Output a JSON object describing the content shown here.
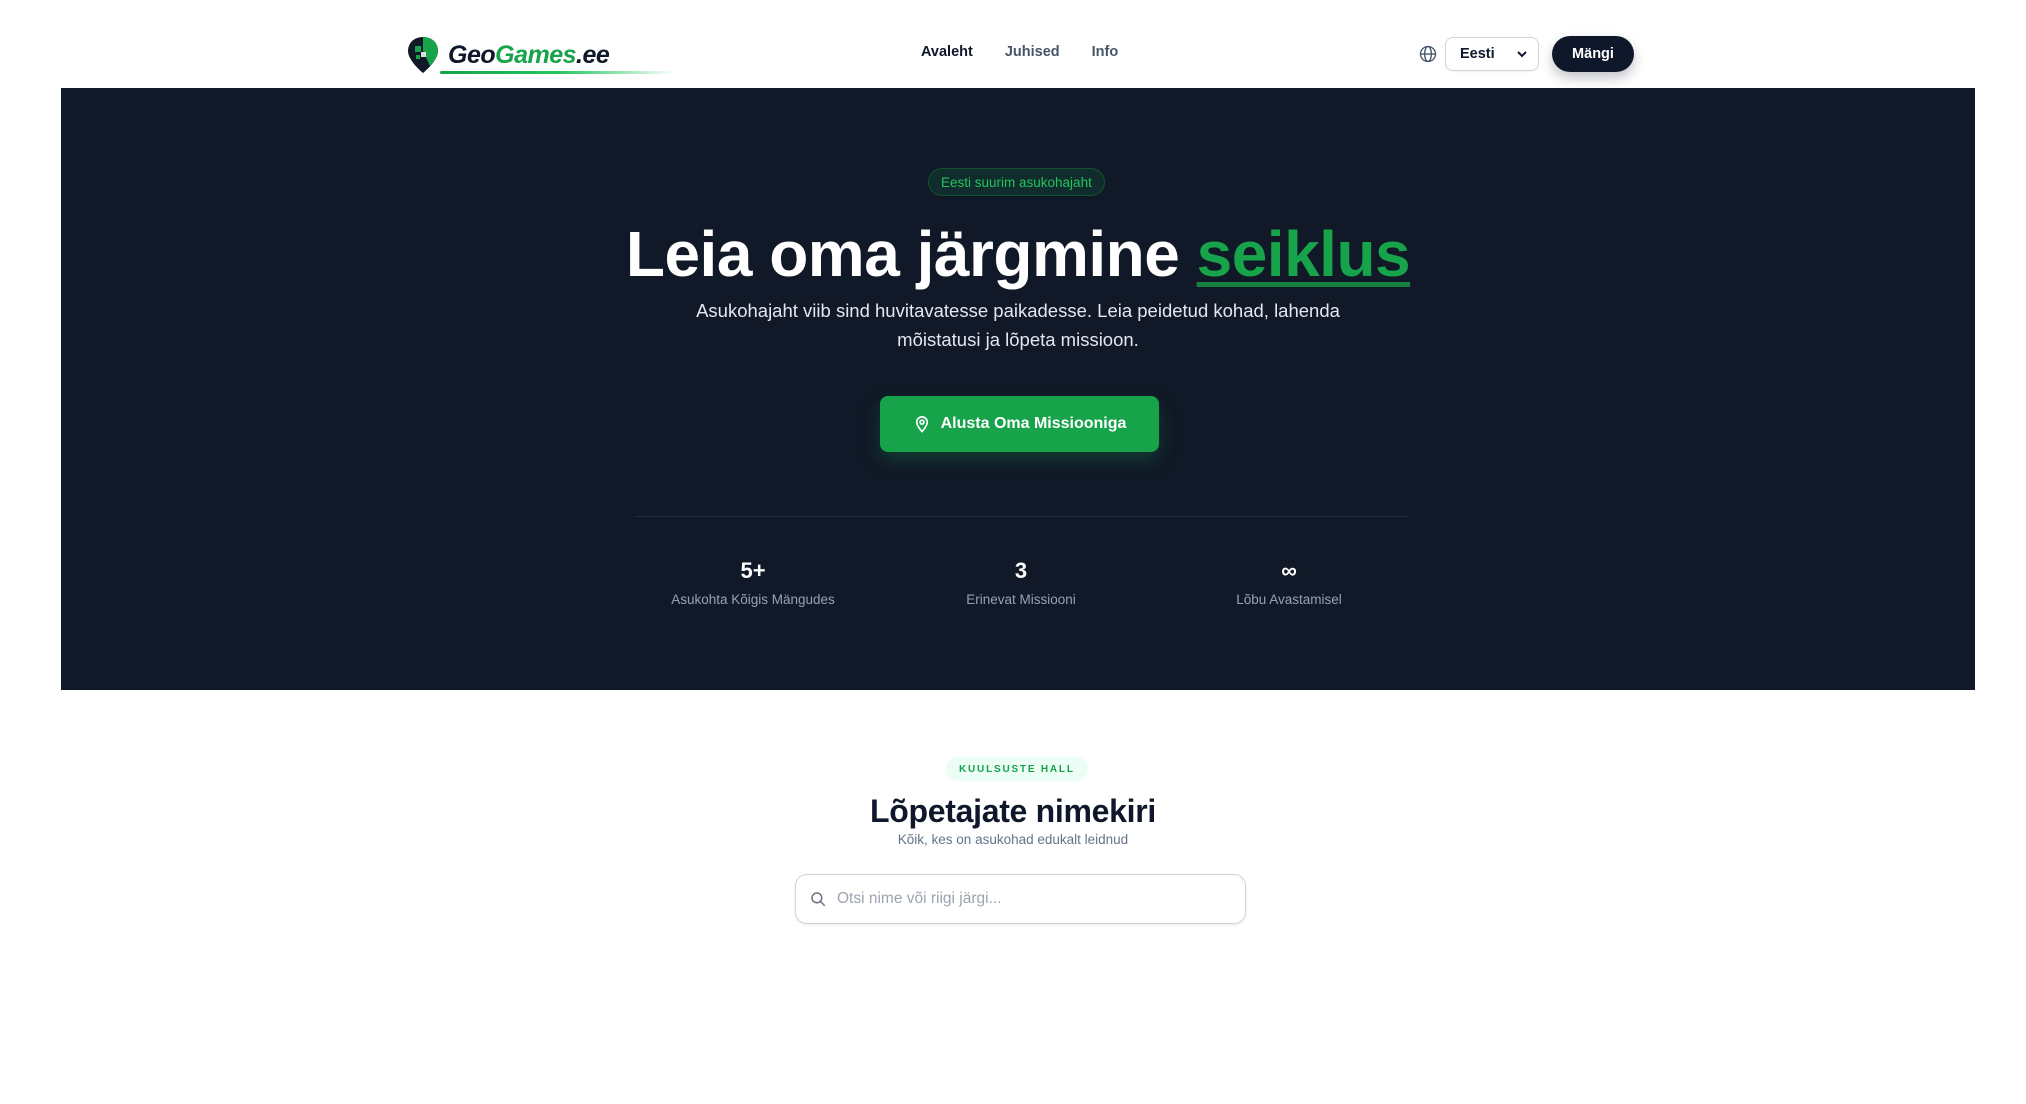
{
  "header": {
    "logo_part1": "Geo",
    "logo_part2": "Games",
    "logo_part3": ".ee",
    "nav": [
      {
        "label": "Avaleht",
        "active": true
      },
      {
        "label": "Juhised",
        "active": false
      },
      {
        "label": "Info",
        "active": false
      }
    ],
    "language": {
      "selected": "Eesti",
      "icon": "globe-icon"
    },
    "play_label": "Mängi"
  },
  "hero": {
    "badge": "Eesti suurim asukohajaht",
    "title_main": "Leia oma järgmine ",
    "title_accent": "seiklus",
    "subtitle": "Asukohajaht viib sind huvitavatesse paikadesse. Leia peidetud kohad, lahenda mõistatusi ja lõpeta missioon.",
    "cta_label": "Alusta Oma Missiooniga",
    "cta_icon": "map-pin-icon",
    "stats": [
      {
        "value": "5+",
        "label": "Asukohta Kõigis Mängudes"
      },
      {
        "value": "3",
        "label": "Erinevat Missiooni"
      },
      {
        "value": "∞",
        "label": "Lõbu Avastamisel"
      }
    ]
  },
  "leaderboard": {
    "tag": "KUULSUSTE HALL",
    "title": "Lõpetajate nimekiri",
    "subtitle": "Kõik, kes on asukohad edukalt leidnud",
    "search_placeholder": "Otsi nime või riigi järgi...",
    "search_value": ""
  },
  "colors": {
    "accent": "#16a34a",
    "dark": "#111827",
    "navy": "#0f172a"
  }
}
